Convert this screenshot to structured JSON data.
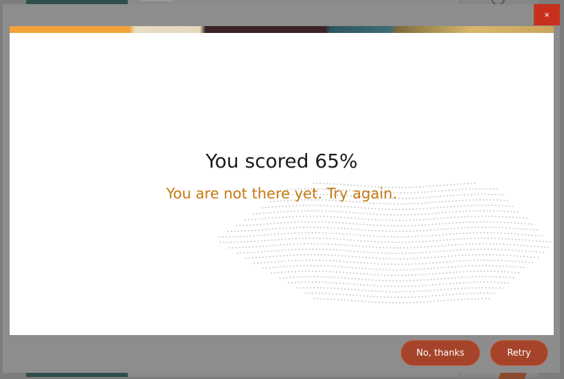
{
  "dialog": {
    "close_symbol": "×",
    "score_text": "You scored 65%",
    "message": "You are not there yet. Try again.",
    "no_thanks_label": "No, thanks",
    "retry_label": "Retry"
  },
  "colors": {
    "accent": "#a5442a",
    "close": "#c8301e",
    "message": "#c4780f",
    "overlay": "#7d7d7d"
  },
  "icons": {
    "close": "close-icon",
    "decoration": "dotted-pattern-decoration"
  }
}
